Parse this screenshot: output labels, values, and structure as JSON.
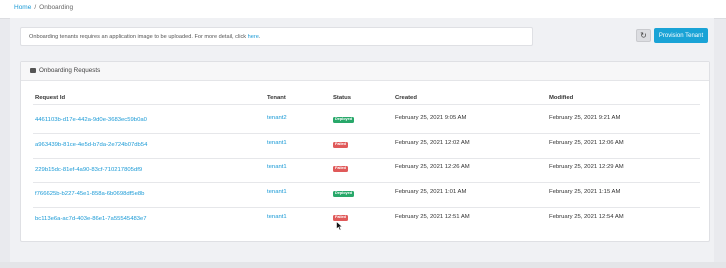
{
  "breadcrumb": {
    "home": "Home",
    "separator": "/",
    "current": "Onboarding"
  },
  "notice": {
    "text": "Onboarding tenants requires an application image to be uploaded. For more detail, click",
    "link": "here",
    "suffix": "."
  },
  "toolbar": {
    "refresh_icon": "refresh-icon",
    "provision_label": "Provision Tenant"
  },
  "card": {
    "title": "Onboarding Requests",
    "icon": "list-icon"
  },
  "table": {
    "columns": [
      "Request Id",
      "Tenant",
      "Status",
      "Created",
      "Modified"
    ],
    "rows": [
      {
        "id": "4461103b-d17e-442a-9d0e-3683ec59b0a0",
        "tenant": "tenant2",
        "status": "Deployed",
        "created": "February 25, 2021 9:05 AM",
        "modified": "February 25, 2021 9:21 AM"
      },
      {
        "id": "a963439b-81ce-4e5d-b7da-2e724b07db54",
        "tenant": "tenant1",
        "status": "Failed",
        "created": "February 25, 2021 12:02 AM",
        "modified": "February 25, 2021 12:06 AM"
      },
      {
        "id": "229b15dc-81ef-4a90-83cf-710217805df9",
        "tenant": "tenant1",
        "status": "Failed",
        "created": "February 25, 2021 12:26 AM",
        "modified": "February 25, 2021 12:29 AM"
      },
      {
        "id": "f766625b-b227-45e1-858a-6b0698df5e8b",
        "tenant": "tenant1",
        "status": "Deployed",
        "created": "February 25, 2021 1:01 AM",
        "modified": "February 25, 2021 1:15 AM"
      },
      {
        "id": "bc113e6a-ac7d-403e-86e1-7a55545483e7",
        "tenant": "tenant1",
        "status": "Failed",
        "created": "February 25, 2021 12:51 AM",
        "modified": "February 25, 2021 12:54 AM"
      }
    ]
  },
  "colors": {
    "link": "#1a9ad6",
    "primary": "#1aa3d6",
    "deployed": "#28a86a",
    "failed": "#e05a5a"
  }
}
